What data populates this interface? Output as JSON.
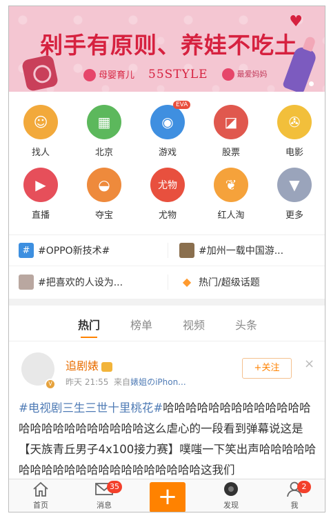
{
  "banner": {
    "headline": "剁手有原则、养娃不吃土",
    "brand1": "母婴育儿",
    "brand2": "55STYLE",
    "brand3": "最爱妈妈"
  },
  "grid": [
    {
      "label": "找人",
      "icon": "find-people-icon",
      "color": "#f2a93b",
      "glyph": "☺"
    },
    {
      "label": "北京",
      "icon": "city-building-icon",
      "color": "#5cb85c",
      "glyph": "▦"
    },
    {
      "label": "游戏",
      "icon": "gamepad-icon",
      "color": "#3f8fe0",
      "glyph": "◉",
      "badge": "EVA"
    },
    {
      "label": "股票",
      "icon": "stock-chart-icon",
      "color": "#e0584e",
      "glyph": "◪"
    },
    {
      "label": "电影",
      "icon": "film-reel-icon",
      "color": "#f2bf3b",
      "glyph": "✇"
    },
    {
      "label": "直播",
      "icon": "live-video-icon",
      "color": "#e64f5a",
      "glyph": "▶"
    },
    {
      "label": "夺宝",
      "icon": "treasure-bowl-icon",
      "color": "#ee8a3c",
      "glyph": "◒"
    },
    {
      "label": "尤物",
      "icon": "youwu-logo-icon",
      "color": "#e8503e",
      "glyph": "尤物"
    },
    {
      "label": "红人淘",
      "icon": "shopping-bag-icon",
      "color": "#f5a23b",
      "glyph": "❦"
    },
    {
      "label": "更多",
      "icon": "more-chevron-icon",
      "color": "#9aa4bb",
      "glyph": "▼"
    }
  ],
  "topics": [
    {
      "text": "#OPPO新技术#",
      "icon": "hashtag-icon",
      "color": "#3d8fe0"
    },
    {
      "text": "#加州一载中国游...",
      "icon": "topic-thumbnail-icon",
      "color": "#8a6f4e"
    },
    {
      "text": "#把喜欢的人设为...",
      "icon": "topic-avatar-icon",
      "color": "#b9a7a0"
    },
    {
      "text": "热门/超级话题",
      "icon": "hot-topic-diamond-icon",
      "color": "#ff9a2e"
    }
  ],
  "tabs": [
    "热门",
    "榜单",
    "视频",
    "头条"
  ],
  "post": {
    "username": "追剧婊",
    "time": "昨天 21:55",
    "source_prefix": "来自",
    "source": "婊姐のiPhon...",
    "follow": "+关注",
    "close": "×",
    "topic": "#电视剧三生三世十里桃花#",
    "body": "哈哈哈哈哈哈哈哈哈哈哈哈哈哈哈哈哈哈哈哈哈哈哈哈这么虐心的一段看到弹幕说这是【天族青丘男子4x100接力赛】噗嗤一下笑出声哈哈哈哈哈哈哈哈哈哈哈哈哈哈哈哈哈哈哈哈哈这我们"
  },
  "bottom_nav": {
    "home": "首页",
    "messages": "消息",
    "messages_count": "35",
    "plus": "+",
    "discover": "发现",
    "me": "我",
    "me_count": "2"
  },
  "colors": {
    "accent": "#ff8200",
    "topic_link": "#4f7bb5",
    "banner_red": "#d6213f"
  }
}
